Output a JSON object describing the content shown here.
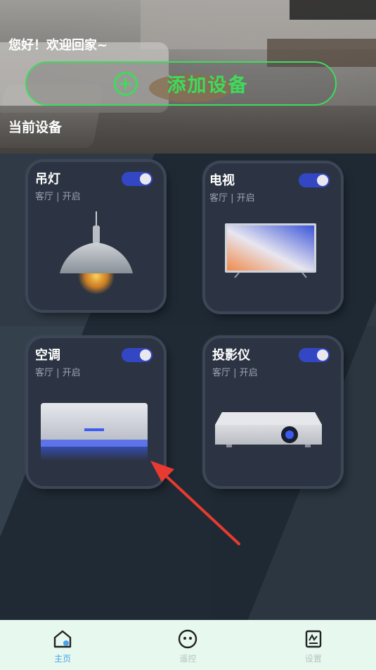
{
  "header": {
    "greeting": "您好！欢迎回家~",
    "add_button_label": "添加设备",
    "add_icon": "plus-circle-icon",
    "section_title": "当前设备"
  },
  "devices": [
    {
      "name": "吊灯",
      "location": "客厅 | 开启",
      "on": true,
      "icon": "pendant-lamp-icon"
    },
    {
      "name": "电视",
      "location": "客厅 | 开启",
      "on": true,
      "icon": "tv-icon"
    },
    {
      "name": "空调",
      "location": "客厅 | 开启",
      "on": true,
      "icon": "air-conditioner-icon"
    },
    {
      "name": "投影仪",
      "location": "客厅 | 开启",
      "on": true,
      "icon": "projector-icon"
    }
  ],
  "nav": {
    "items": [
      {
        "label": "主页",
        "icon": "home-icon",
        "active": true
      },
      {
        "label": "遥控",
        "icon": "remote-icon",
        "active": false
      },
      {
        "label": "设置",
        "icon": "settings-icon",
        "active": false
      }
    ]
  },
  "colors": {
    "accent_green": "#3ddc5a",
    "toggle_on": "#3347c4",
    "nav_active": "#4aa3e8",
    "nav_inactive": "#b7c4be",
    "arrow": "#e83a30"
  }
}
